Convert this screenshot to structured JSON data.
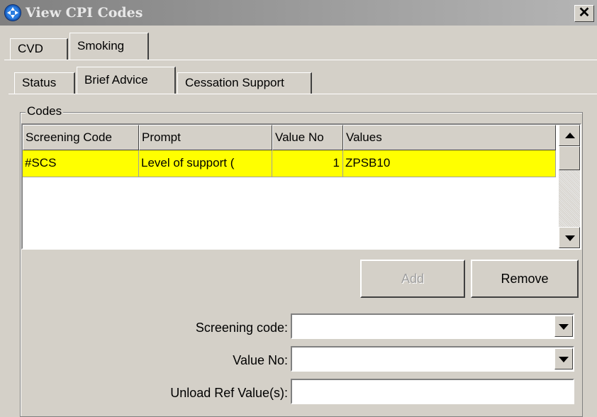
{
  "window": {
    "title": "View CPI Codes"
  },
  "tabs_top": [
    {
      "label": "CVD",
      "active": false
    },
    {
      "label": "Smoking",
      "active": true
    }
  ],
  "tabs_sub": [
    {
      "label": "Status",
      "active": false
    },
    {
      "label": "Brief Advice",
      "active": true
    },
    {
      "label": "Cessation Support",
      "active": false
    }
  ],
  "codes_group": {
    "label": "Codes"
  },
  "grid": {
    "columns": [
      "Screening Code",
      "Prompt",
      "Value No",
      "Values"
    ],
    "rows": [
      {
        "screening_code": "#SCS",
        "prompt": "Level of support (",
        "value_no": "1",
        "values": "ZPSB10"
      }
    ],
    "highlight_color": "#ffff00"
  },
  "buttons": {
    "add": "Add",
    "remove": "Remove"
  },
  "form": {
    "screening_code_label": "Screening code:",
    "screening_code_value": "",
    "value_no_label": "Value No:",
    "value_no_value": "",
    "unload_ref_label": "Unload Ref Value(s):",
    "unload_ref_value": ""
  }
}
